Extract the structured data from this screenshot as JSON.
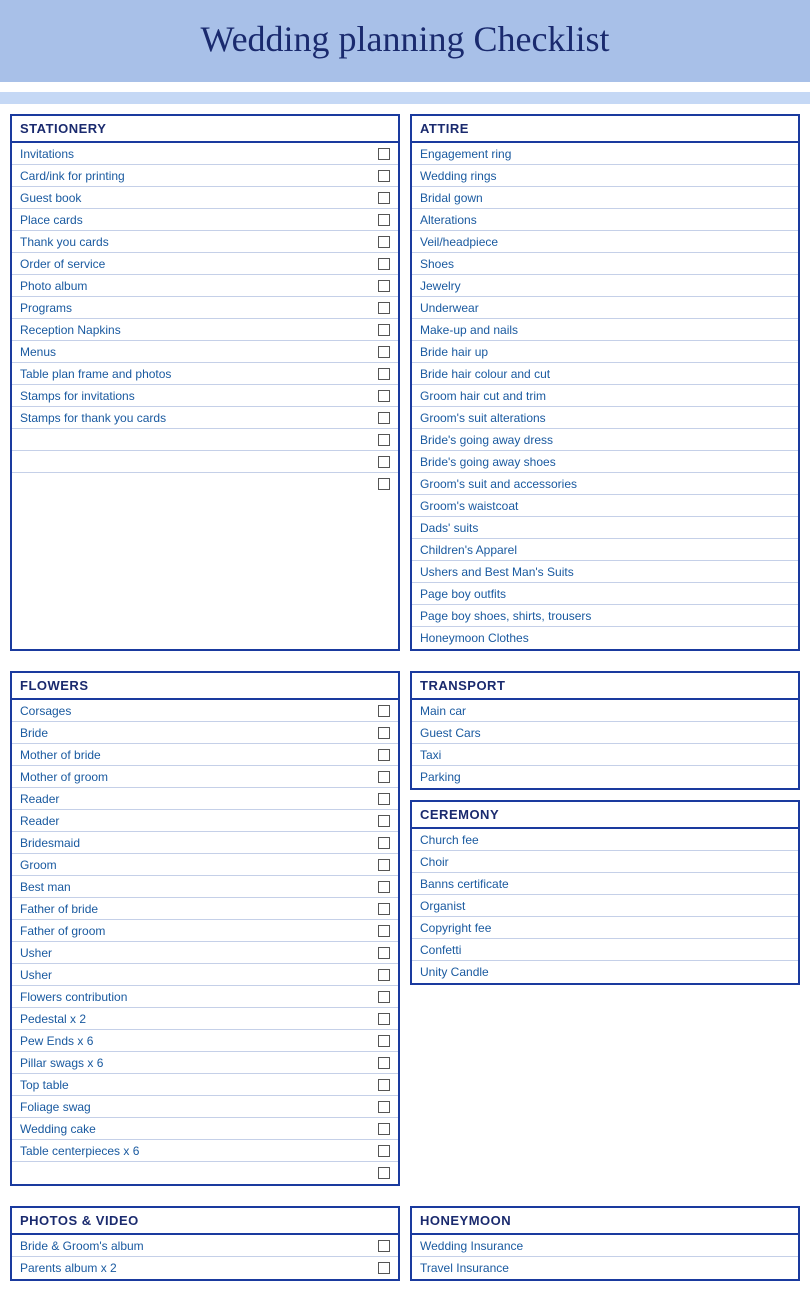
{
  "title": "Wedding planning Checklist",
  "sections": {
    "stationery": {
      "header": "STATIONERY",
      "items": [
        "Invitations",
        "Card/ink for printing",
        "Guest book",
        "Place cards",
        "Thank you cards",
        "Order of service",
        "Photo album",
        "Programs",
        "Reception Napkins",
        "Menus",
        "Table plan frame and photos",
        "Stamps for invitations",
        "Stamps for thank you cards",
        "",
        "",
        ""
      ]
    },
    "attire": {
      "header": "ATTIRE",
      "items": [
        "Engagement ring",
        "Wedding rings",
        "Bridal gown",
        "Alterations",
        "Veil/headpiece",
        "Shoes",
        "Jewelry",
        "Underwear",
        "Make-up and nails",
        "Bride hair up",
        "Bride hair colour and cut",
        "Groom hair cut and trim",
        "Groom's suit alterations",
        "Bride's going away dress",
        "Bride's going away shoes",
        "Groom's suit and accessories",
        "Groom's waistcoat",
        "Dads' suits",
        "Children's Apparel",
        "Ushers and Best Man's Suits",
        "Page boy outfits",
        "Page boy shoes, shirts, trousers",
        "Honeymoon Clothes"
      ]
    },
    "flowers": {
      "header": "FLOWERS",
      "items": [
        "Corsages",
        "Bride",
        "Mother of bride",
        "Mother of groom",
        "Reader",
        "Reader",
        "Bridesmaid",
        "Groom",
        "Best man",
        "Father of bride",
        "Father of groom",
        "Usher",
        "Usher",
        "Flowers contribution",
        "Pedestal x 2",
        "Pew Ends x 6",
        "Pillar swags x 6",
        "Top table",
        "Foliage swag",
        "Wedding cake",
        "Table centerpieces x 6",
        ""
      ]
    },
    "transport": {
      "header": "TRANSPORT",
      "items": [
        "Main car",
        "Guest Cars",
        "Taxi",
        "Parking"
      ]
    },
    "ceremony": {
      "header": "CEREMONY",
      "items": [
        "Church fee",
        "Choir",
        "Banns certificate",
        "Organist",
        "Copyright fee",
        "Confetti",
        "Unity Candle"
      ]
    },
    "photos": {
      "header": "PHOTOS & VIDEO",
      "items": [
        "Bride & Groom's album",
        "Parents album x 2"
      ]
    },
    "honeymoon": {
      "header": "HONEYMOON",
      "items": [
        "Wedding Insurance",
        "Travel Insurance"
      ]
    }
  }
}
